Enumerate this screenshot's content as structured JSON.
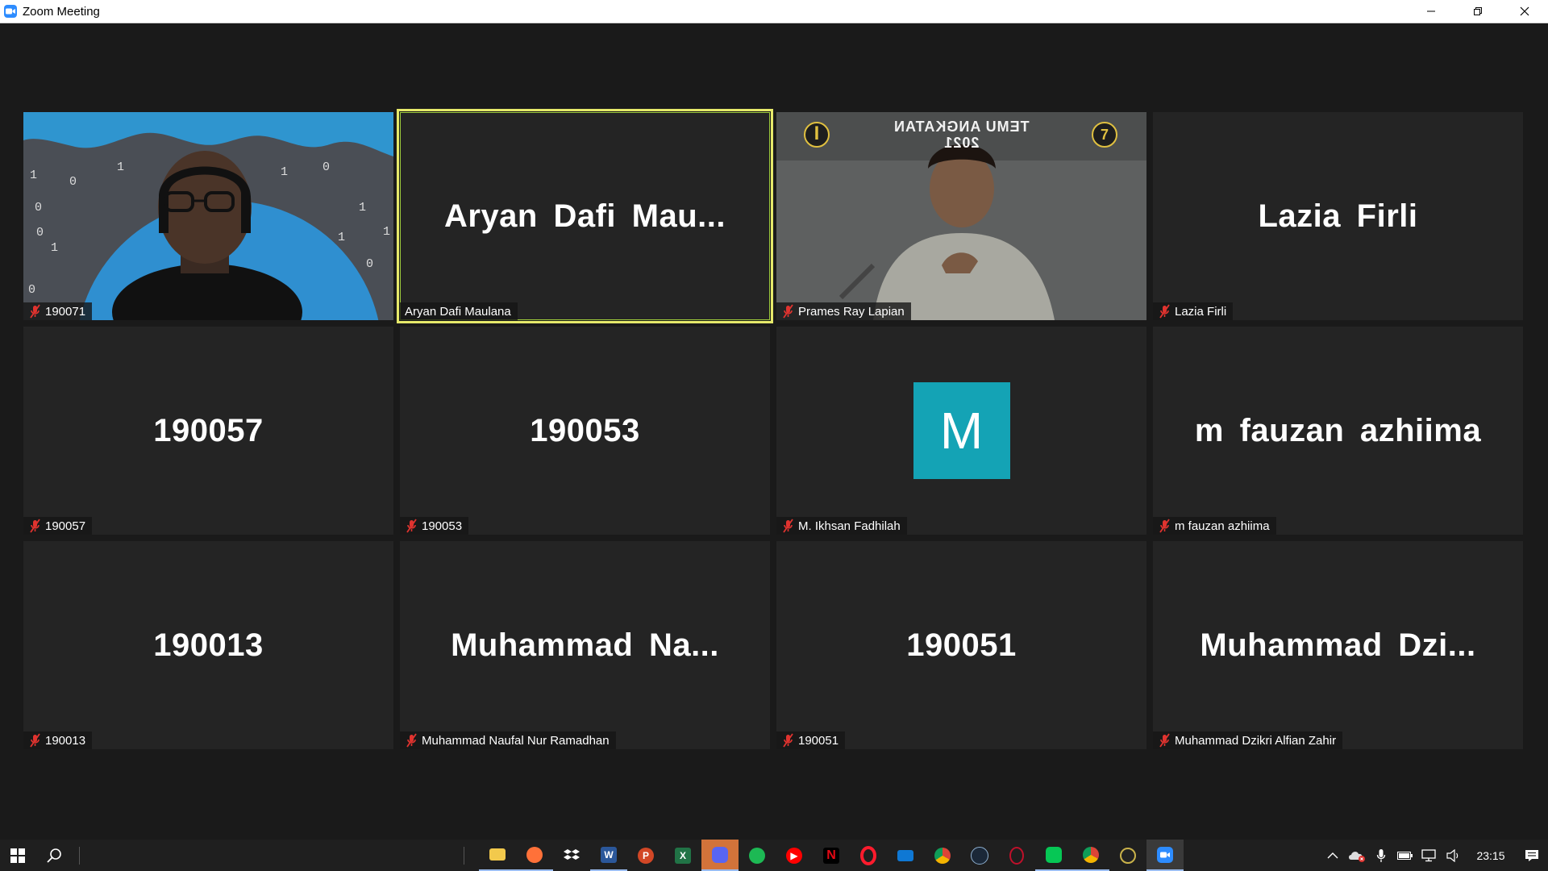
{
  "window": {
    "title": "Zoom Meeting",
    "minimize_icon": "minimize-icon",
    "restore_icon": "restore-icon",
    "close_icon": "close-icon"
  },
  "participants": [
    {
      "display": "",
      "caption": "190071",
      "muted": true,
      "video": true
    },
    {
      "display": "Aryan  Dafi  Mau...",
      "caption": "Aryan Dafi Maulana",
      "muted": false,
      "active_speaker": true
    },
    {
      "display": "",
      "caption": "Prames Ray Lapian",
      "muted": true,
      "video": true,
      "banner_line1": "TEMU ANGKATAN",
      "banner_line2": "2021"
    },
    {
      "display": "Lazia Firli",
      "caption": "Lazia Firli",
      "muted": true
    },
    {
      "display": "190057",
      "caption": "190057",
      "muted": true
    },
    {
      "display": "190053",
      "caption": "190053",
      "muted": true
    },
    {
      "display": "M",
      "caption": "M. Ikhsan Fadhilah",
      "muted": true,
      "avatar": true,
      "avatar_color": "#14a3b5"
    },
    {
      "display": "m fauzan azhiima",
      "caption": "m fauzan azhiima",
      "muted": true
    },
    {
      "display": "190013",
      "caption": "190013",
      "muted": true
    },
    {
      "display": "Muhammad  Na...",
      "caption": "Muhammad Naufal Nur Ramadhan",
      "muted": true
    },
    {
      "display": "190051",
      "caption": "190051",
      "muted": true
    },
    {
      "display": "Muhammad  Dzi...",
      "caption": "Muhammad Dzikri Alfian Zahir",
      "muted": true
    }
  ],
  "video_background": {
    "digits": [
      "1",
      "0",
      "1",
      "0",
      "1",
      "0",
      "1",
      "1",
      "0",
      "0",
      "0",
      "1",
      "1",
      "0",
      "1",
      "0",
      "1"
    ]
  },
  "taskbar": {
    "apps": [
      "file-explorer-icon",
      "firefox-icon",
      "dropbox-icon",
      "word-icon",
      "powerpoint-icon",
      "excel-icon",
      "discord-icon",
      "spotify-icon",
      "youtube-icon",
      "netflix-icon",
      "opera-icon",
      "mail-icon",
      "chrome-icon",
      "steam-icon",
      "opera-gx-icon",
      "line-icon",
      "chrome-2-icon",
      "unknown-app-icon",
      "zoom-icon"
    ],
    "clock": "23:15"
  },
  "colors": {
    "active_speaker_border": "#e6e96a",
    "tile_bg": "#242424",
    "stage_bg": "#1a1a1a",
    "mute_red": "#e0332f"
  }
}
